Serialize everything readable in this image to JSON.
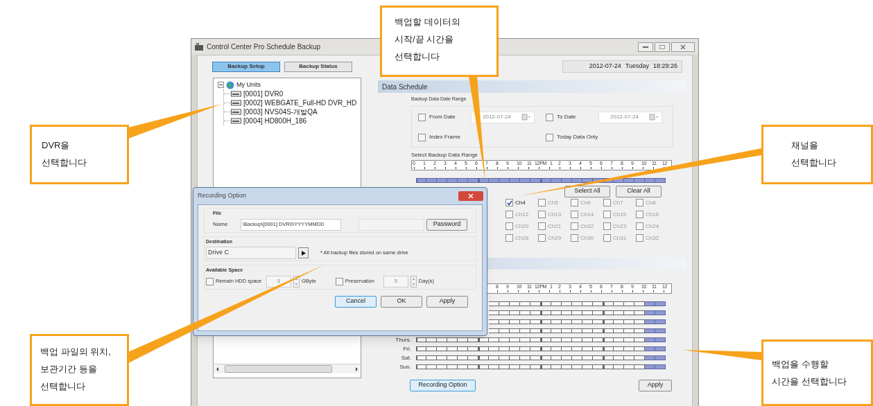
{
  "callouts": [
    {
      "text": "백업할 데이터의\n시작/끝 시간을\n선택합니다"
    },
    {
      "text": "DVR을\n선택합니다"
    },
    {
      "text": "채널을\n선택합니다"
    },
    {
      "text": "백업 파일의 위치,\n보관기간 등을\n선택합니다"
    },
    {
      "text": "백업을 수행할\n시간을 선택합니다"
    }
  ],
  "window": {
    "title": "Control Center Pro Schedule Backup",
    "tabs": [
      {
        "label": "Backup Setup",
        "selected": true
      },
      {
        "label": "Backup Status",
        "selected": false
      }
    ],
    "date": "2012-07-24",
    "day": "Tuesday",
    "time": "18:29:26"
  },
  "tree": {
    "label": "My Units",
    "expanded": true,
    "children": [
      {
        "label": "[0001] DVR0"
      },
      {
        "label": "[0002] WEBGATE_Full-HD DVR_HD"
      },
      {
        "label": "[0003] NVS04S-개발QA"
      },
      {
        "label": "[0004] HD800H_186"
      }
    ]
  },
  "data_schedule": {
    "title": "Data Schedule",
    "date_range_label": "Backup Data Date Range",
    "from": {
      "label": "From Date",
      "checked": false,
      "value": "2012-07-24"
    },
    "to": {
      "label": "To Date",
      "checked": false,
      "value": "2012-07-24"
    },
    "index_frame": {
      "label": "Index Frame",
      "checked": false
    },
    "today_only": {
      "label": "Today Data Only",
      "checked": false
    },
    "range_label": "Select Backup Data Range",
    "hours": [
      "0",
      "1",
      "2",
      "3",
      "4",
      "5",
      "6",
      "7",
      "8",
      "9",
      "10",
      "11",
      "12PM",
      "1",
      "2",
      "3",
      "4",
      "5",
      "6",
      "7",
      "8",
      "9",
      "10",
      "11",
      "12"
    ],
    "slots": [
      {
        "selected": true
      },
      {
        "selected": true
      },
      {
        "selected": true
      },
      {
        "selected": true
      },
      {
        "selected": true
      },
      {
        "selected": true
      },
      {
        "selected": true
      },
      {
        "selected": true
      },
      {
        "selected": true
      },
      {
        "selected": true
      },
      {
        "selected": true
      },
      {
        "selected": true
      },
      {
        "selected": true
      },
      {
        "selected": true
      },
      {
        "selected": true
      },
      {
        "selected": true
      },
      {
        "selected": true
      },
      {
        "selected": true
      },
      {
        "selected": true
      },
      {
        "selected": true
      },
      {
        "selected": true
      },
      {
        "selected": true
      },
      {
        "selected": true
      },
      {
        "selected": true
      }
    ],
    "select_all": "Select All",
    "clear_all": "Clear All",
    "channels": [
      [
        {
          "label": "Ch4",
          "checked": true
        },
        {
          "label": "Ch5",
          "checked": false
        },
        {
          "label": "Ch6",
          "checked": false
        },
        {
          "label": "Ch7",
          "checked": false
        },
        {
          "label": "Ch8",
          "checked": false
        }
      ],
      [
        {
          "label": "Ch12",
          "checked": false
        },
        {
          "label": "Ch13",
          "checked": false
        },
        {
          "label": "Ch14",
          "checked": false
        },
        {
          "label": "Ch15",
          "checked": false
        },
        {
          "label": "Ch16",
          "checked": false
        }
      ],
      [
        {
          "label": "Ch20",
          "checked": false
        },
        {
          "label": "Ch21",
          "checked": false
        },
        {
          "label": "Ch22",
          "checked": false
        },
        {
          "label": "Ch23",
          "checked": false
        },
        {
          "label": "Ch24",
          "checked": false
        }
      ],
      [
        {
          "label": "Ch28",
          "checked": false
        },
        {
          "label": "Ch29",
          "checked": false
        },
        {
          "label": "Ch30",
          "checked": false
        },
        {
          "label": "Ch31",
          "checked": false
        },
        {
          "label": "Ch32",
          "checked": false
        }
      ]
    ]
  },
  "recording_schedule": {
    "hours": [
      "8",
      "9",
      "10",
      "11",
      "12PM",
      "1",
      "2",
      "3",
      "4",
      "5",
      "6",
      "7",
      "8",
      "9",
      "10",
      "11",
      "12"
    ],
    "days": [
      {
        "slots": [
          {
            "selected": false
          },
          {
            "selected": false
          },
          {
            "selected": false
          },
          {
            "selected": false
          },
          {
            "selected": false
          },
          {
            "selected": false
          },
          {
            "selected": false
          },
          {
            "selected": false
          },
          {
            "selected": false
          },
          {
            "selected": false
          },
          {
            "selected": false
          },
          {
            "selected": false
          },
          {
            "selected": false
          },
          {
            "selected": false
          },
          {
            "selected": false
          },
          {
            "selected": true
          },
          {
            "selected": true
          }
        ]
      },
      {
        "slots": [
          {
            "selected": false
          },
          {
            "selected": false
          },
          {
            "selected": false
          },
          {
            "selected": false
          },
          {
            "selected": false
          },
          {
            "selected": false
          },
          {
            "selected": false
          },
          {
            "selected": false
          },
          {
            "selected": false
          },
          {
            "selected": false
          },
          {
            "selected": false
          },
          {
            "selected": false
          },
          {
            "selected": false
          },
          {
            "selected": false
          },
          {
            "selected": false
          },
          {
            "selected": true
          },
          {
            "selected": true
          }
        ]
      },
      {
        "slots": [
          {
            "selected": false
          },
          {
            "selected": false
          },
          {
            "selected": false
          },
          {
            "selected": false
          },
          {
            "selected": false
          },
          {
            "selected": false
          },
          {
            "selected": false
          },
          {
            "selected": false
          },
          {
            "selected": false
          },
          {
            "selected": false
          },
          {
            "selected": false
          },
          {
            "selected": false
          },
          {
            "selected": false
          },
          {
            "selected": false
          },
          {
            "selected": false
          },
          {
            "selected": true
          },
          {
            "selected": true
          }
        ]
      },
      {
        "slots": [
          {
            "selected": false
          },
          {
            "selected": false
          },
          {
            "selected": false
          },
          {
            "selected": false
          },
          {
            "selected": false
          },
          {
            "selected": false
          },
          {
            "selected": false
          },
          {
            "selected": false
          },
          {
            "selected": false
          },
          {
            "selected": false
          },
          {
            "selected": false
          },
          {
            "selected": false
          },
          {
            "selected": false
          },
          {
            "selected": false
          },
          {
            "selected": false
          },
          {
            "selected": true
          },
          {
            "selected": true
          }
        ]
      },
      {
        "label": "Thurs.",
        "slots": [
          {
            "selected": false
          },
          {
            "selected": false
          },
          {
            "selected": false
          },
          {
            "selected": false
          },
          {
            "selected": false
          },
          {
            "selected": false
          },
          {
            "selected": false
          },
          {
            "selected": false
          },
          {
            "selected": false
          },
          {
            "selected": false
          },
          {
            "selected": false
          },
          {
            "selected": false
          },
          {
            "selected": false
          },
          {
            "selected": false
          },
          {
            "selected": false
          },
          {
            "selected": false
          },
          {
            "selected": false
          },
          {
            "selected": false
          },
          {
            "selected": false
          },
          {
            "selected": false
          },
          {
            "selected": false
          },
          {
            "selected": false
          },
          {
            "selected": true
          },
          {
            "selected": true
          }
        ]
      },
      {
        "label": "Fri.",
        "slots": [
          {
            "selected": false
          },
          {
            "selected": false
          },
          {
            "selected": false
          },
          {
            "selected": false
          },
          {
            "selected": false
          },
          {
            "selected": false
          },
          {
            "selected": false
          },
          {
            "selected": false
          },
          {
            "selected": false
          },
          {
            "selected": false
          },
          {
            "selected": false
          },
          {
            "selected": false
          },
          {
            "selected": false
          },
          {
            "selected": false
          },
          {
            "selected": false
          },
          {
            "selected": false
          },
          {
            "selected": false
          },
          {
            "selected": false
          },
          {
            "selected": false
          },
          {
            "selected": false
          },
          {
            "selected": false
          },
          {
            "selected": false
          },
          {
            "selected": true
          },
          {
            "selected": true
          }
        ]
      },
      {
        "label": "Sat.",
        "slots": [
          {
            "selected": false
          },
          {
            "selected": false
          },
          {
            "selected": false
          },
          {
            "selected": false
          },
          {
            "selected": false
          },
          {
            "selected": false
          },
          {
            "selected": false
          },
          {
            "selected": false
          },
          {
            "selected": false
          },
          {
            "selected": false
          },
          {
            "selected": false
          },
          {
            "selected": false
          },
          {
            "selected": false
          },
          {
            "selected": false
          },
          {
            "selected": false
          },
          {
            "selected": false
          },
          {
            "selected": false
          },
          {
            "selected": false
          },
          {
            "selected": false
          },
          {
            "selected": false
          },
          {
            "selected": false
          },
          {
            "selected": false
          },
          {
            "selected": true
          },
          {
            "selected": true
          }
        ]
      },
      {
        "label": "Sun.",
        "slots": [
          {
            "selected": false
          },
          {
            "selected": false
          },
          {
            "selected": false
          },
          {
            "selected": false
          },
          {
            "selected": false
          },
          {
            "selected": false
          },
          {
            "selected": false
          },
          {
            "selected": false
          },
          {
            "selected": false
          },
          {
            "selected": false
          },
          {
            "selected": false
          },
          {
            "selected": false
          },
          {
            "selected": false
          },
          {
            "selected": false
          },
          {
            "selected": false
          },
          {
            "selected": false
          },
          {
            "selected": false
          },
          {
            "selected": false
          },
          {
            "selected": false
          },
          {
            "selected": false
          },
          {
            "selected": false
          },
          {
            "selected": false
          },
          {
            "selected": true
          },
          {
            "selected": true
          }
        ]
      }
    ],
    "recording_option_button": "Recording Option",
    "apply_button": "Apply"
  },
  "dialog": {
    "title": "Recording Option",
    "file_label": "File",
    "name_label": "Name",
    "name_value": "\\Backup\\[0001] DVR0\\YYYYMMDD",
    "password_button": "Password",
    "destination_label": "Destination",
    "drive": "Drive C",
    "note": "* All backup files stored on same drive",
    "space_label": "Available Space",
    "remain": {
      "label": "Remain HDD space",
      "checked": false,
      "value": "5",
      "unit": "GByte"
    },
    "preservation": {
      "label": "Preservation",
      "checked": false,
      "value": "5",
      "unit": "Day(s)"
    },
    "buttons": [
      {
        "label": "Cancel",
        "focused": true
      },
      {
        "label": "OK",
        "focused": false
      },
      {
        "label": "Apply",
        "focused": false
      }
    ]
  }
}
